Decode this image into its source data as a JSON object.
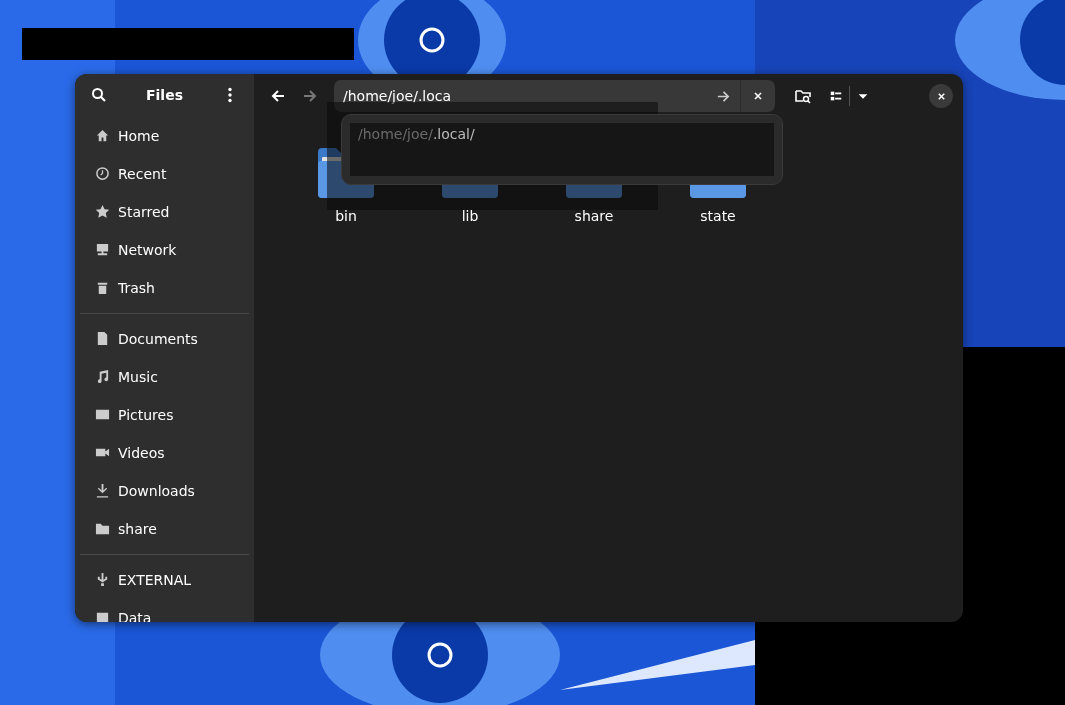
{
  "sidebar": {
    "title": "Files",
    "sections": [
      [
        {
          "label": "Home"
        },
        {
          "label": "Recent"
        },
        {
          "label": "Starred"
        },
        {
          "label": "Network"
        },
        {
          "label": "Trash"
        }
      ],
      [
        {
          "label": "Documents"
        },
        {
          "label": "Music"
        },
        {
          "label": "Pictures"
        },
        {
          "label": "Videos"
        },
        {
          "label": "Downloads"
        },
        {
          "label": "share"
        }
      ],
      [
        {
          "label": "EXTERNAL"
        },
        {
          "label": "Data"
        }
      ]
    ]
  },
  "toolbar": {
    "back": {
      "disabled": false
    },
    "forward": {
      "disabled": true
    },
    "location": {
      "value": "/home/joe/.loca"
    }
  },
  "completion": {
    "prefix": "/home/joe/",
    "suffix": ".local/"
  },
  "folders": [
    {
      "name": "bin"
    },
    {
      "name": "lib"
    },
    {
      "name": "share"
    },
    {
      "name": "state"
    }
  ]
}
